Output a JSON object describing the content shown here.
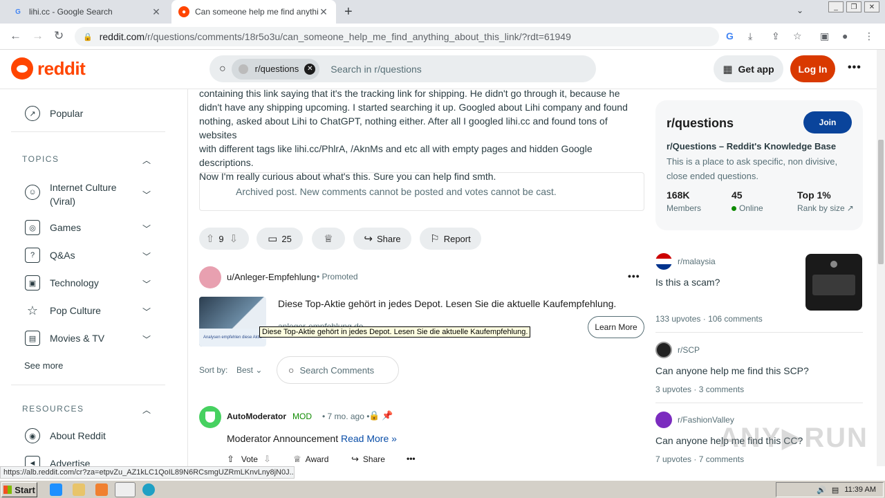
{
  "browser": {
    "tabs": [
      {
        "title": "lihi.cc - Google Search",
        "active": false,
        "favicon": "google-icon"
      },
      {
        "title": "Can someone help me find anything",
        "active": true,
        "favicon": "reddit-icon"
      }
    ],
    "url_host": "reddit.com",
    "url_path": "/r/questions/comments/18r5o3u/can_someone_help_me_find_anything_about_this_link/?rdt=61949",
    "status_url": "https://alb.reddit.com/cr?za=etpvZu_AZ1kLC1QoIL89N6RCsmgUZRmLKnvLny8jN0J..."
  },
  "header": {
    "logo_text": "reddit",
    "search_chip": "r/questions",
    "search_placeholder": "Search in r/questions",
    "get_app": "Get app",
    "login": "Log In",
    "more": "•••"
  },
  "sidebar": {
    "popular": "Popular",
    "topics_heading": "TOPICS",
    "topics": [
      {
        "label": "Internet Culture",
        "label2": "(Viral)",
        "icon": "smile-icon"
      },
      {
        "label": "Games",
        "icon": "gamepad-icon"
      },
      {
        "label": "Q&As",
        "icon": "question-icon"
      },
      {
        "label": "Technology",
        "icon": "chip-icon"
      },
      {
        "label": "Pop Culture",
        "icon": "star-icon"
      },
      {
        "label": "Movies & TV",
        "icon": "clapper-icon"
      }
    ],
    "see_more": "See more",
    "resources_heading": "RESOURCES",
    "resources": [
      {
        "label": "About Reddit",
        "icon": "reddit-alien-icon"
      },
      {
        "label": "Advertise",
        "icon": "megaphone-icon"
      }
    ]
  },
  "post": {
    "body_lines": [
      "containing this link saying that it's the tracking link for shipping. He didn't go through it, because he",
      "didn't have any shipping upcoming. I started searching it up. Googled about Lihi company and found",
      "nothing, asked about Lihi to ChatGPT, nothing either. After all I googled lihi.cc and found tons of websites",
      "with different tags like lihi.cc/PhlrA, /AknMs and etc all with empty pages and hidden Google descriptions.",
      "Now I'm really curious about what's this. Sure you can help find smth."
    ],
    "archived_notice": "Archived post. New comments cannot be posted and votes cannot be cast.",
    "votes": "9",
    "comments": "25",
    "share": "Share",
    "report": "Report"
  },
  "promoted": {
    "user": "u/Anleger-Empfehlung",
    "tag": "Promoted",
    "headline": "Diese Top-Aktie gehört in jedes Depot. Lesen Sie die aktuelle Kaufempfehlung.",
    "domain": "anleger-empfehlung.de",
    "image_caption": "Analysen empfehlen diese Aktie",
    "learn_more": "Learn More",
    "tooltip": "Diese Top-Aktie gehört in jedes Depot. Lesen Sie die aktuelle Kaufempfehlung."
  },
  "comments_bar": {
    "sort_label": "Sort by:",
    "sort_value": "Best",
    "search_placeholder": "Search Comments"
  },
  "comment": {
    "author": "AutoModerator",
    "badge": "MOD",
    "time": "• 7 mo. ago •",
    "text": "Moderator Announcement",
    "read_more": "Read More »",
    "vote": "Vote",
    "award": "Award",
    "share": "Share",
    "more": "•••"
  },
  "community": {
    "name": "r/questions",
    "join": "Join",
    "title": "r/Questions – Reddit's Knowledge Base",
    "description": "This is a place to ask specific, non divisive, close ended questions.",
    "stats": [
      {
        "value": "168K",
        "label": "Members"
      },
      {
        "value": "45",
        "label": "Online"
      },
      {
        "value": "Top 1%",
        "label": "Rank by size"
      }
    ]
  },
  "related": [
    {
      "sub": "r/malaysia",
      "title": "Is this a scam?",
      "upvotes": "133 upvotes",
      "comments": "106 comments"
    },
    {
      "sub": "r/SCP",
      "title": "Can anyone help me find this SCP?",
      "upvotes": "3 upvotes",
      "comments": "3 comments"
    },
    {
      "sub": "r/FashionValley",
      "title": "Can anyone help me find this CC?",
      "upvotes": "7 upvotes",
      "comments": "7 comments"
    }
  ],
  "taskbar": {
    "start": "Start",
    "clock": "11:39 AM"
  },
  "colors": {
    "reddit_orange": "#ff4500",
    "login_bg": "#d93900",
    "join_bg": "#0a449b",
    "mod_green": "#0e8a00",
    "link_blue": "#0a4ea8"
  }
}
